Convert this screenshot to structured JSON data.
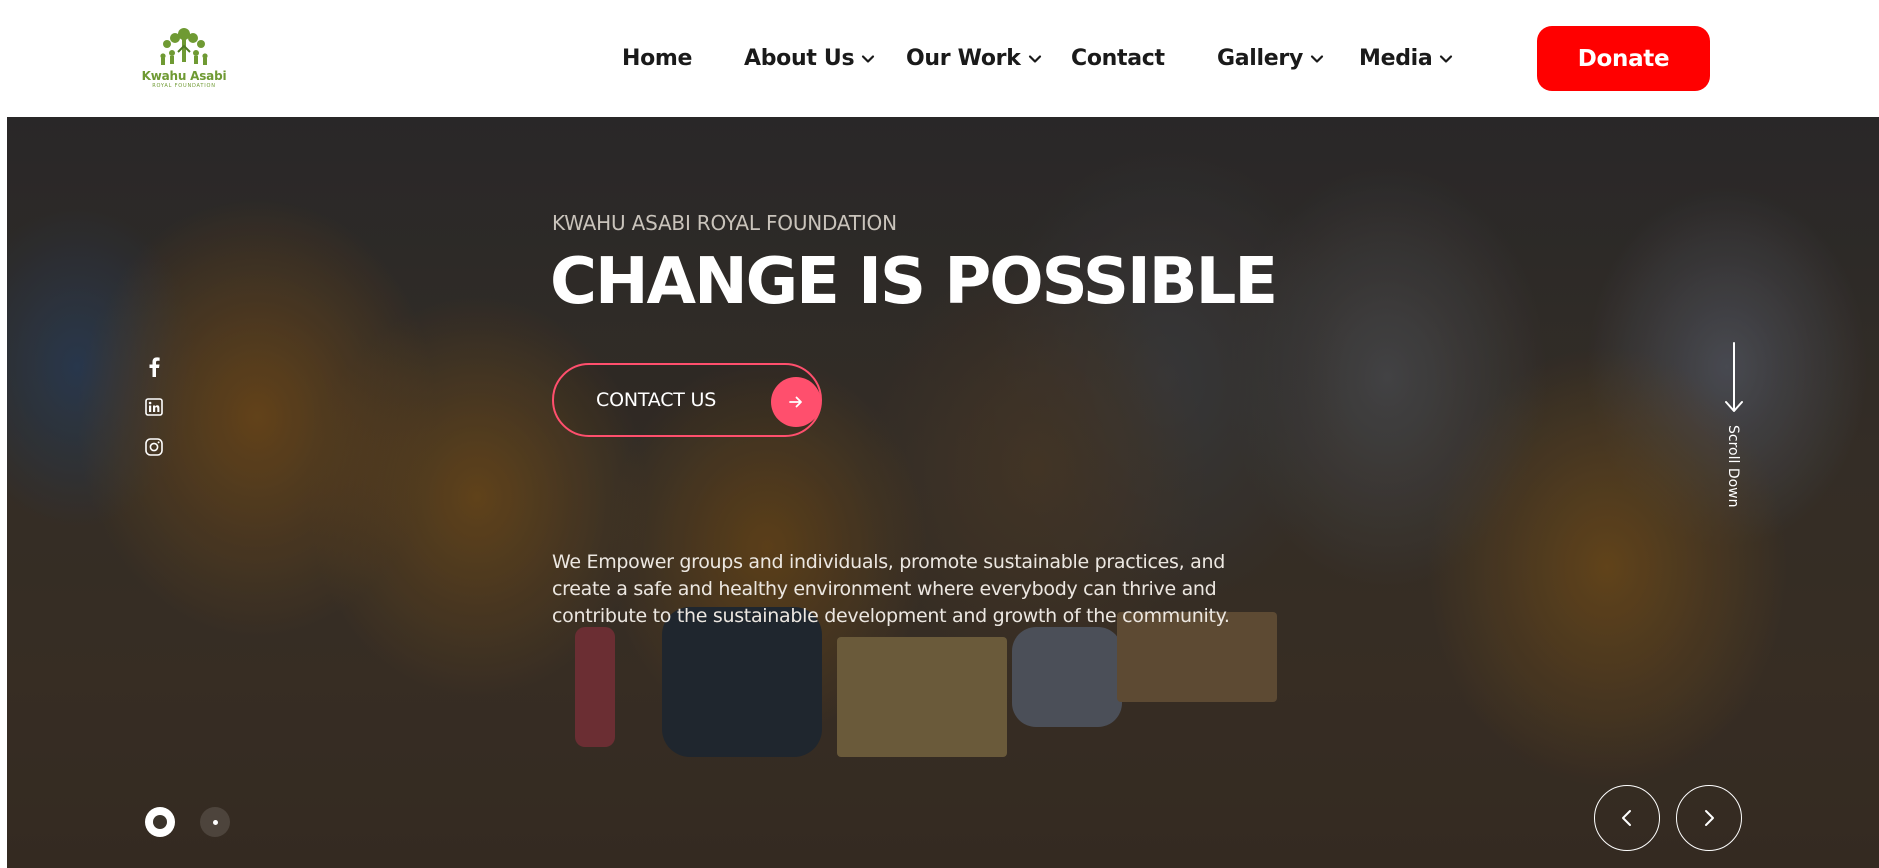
{
  "brand": {
    "name": "Kwahu Asabi",
    "tagline": "ROYAL FOUNDATION"
  },
  "nav": {
    "items": [
      {
        "label": "Home",
        "has_dropdown": false
      },
      {
        "label": "About Us",
        "has_dropdown": true
      },
      {
        "label": "Our Work",
        "has_dropdown": true
      },
      {
        "label": "Contact",
        "has_dropdown": false
      },
      {
        "label": "Gallery",
        "has_dropdown": true
      },
      {
        "label": "Media",
        "has_dropdown": true
      }
    ],
    "donate_label": "Donate"
  },
  "hero": {
    "eyebrow": "KWAHU ASABI ROYAL FOUNDATION",
    "headline": "CHANGE IS POSSIBLE",
    "cta_label": "CONTACT US",
    "description_lines": [
      "We Empower groups and individuals, promote sustainable practices, and",
      "create a safe and healthy environment where everybody can thrive and",
      "contribute to the sustainable development and growth of the community."
    ],
    "scroll_label": "Scroll Down",
    "slides": {
      "total": 2,
      "active": 1
    }
  },
  "social_icons": [
    "facebook-icon",
    "linkedin-icon",
    "instagram-icon"
  ],
  "colors": {
    "donate": "#ff0000",
    "cta_accent": "#ff4f6d",
    "logo_green": "#6f9a33",
    "nav_text": "#1a1a1a"
  }
}
